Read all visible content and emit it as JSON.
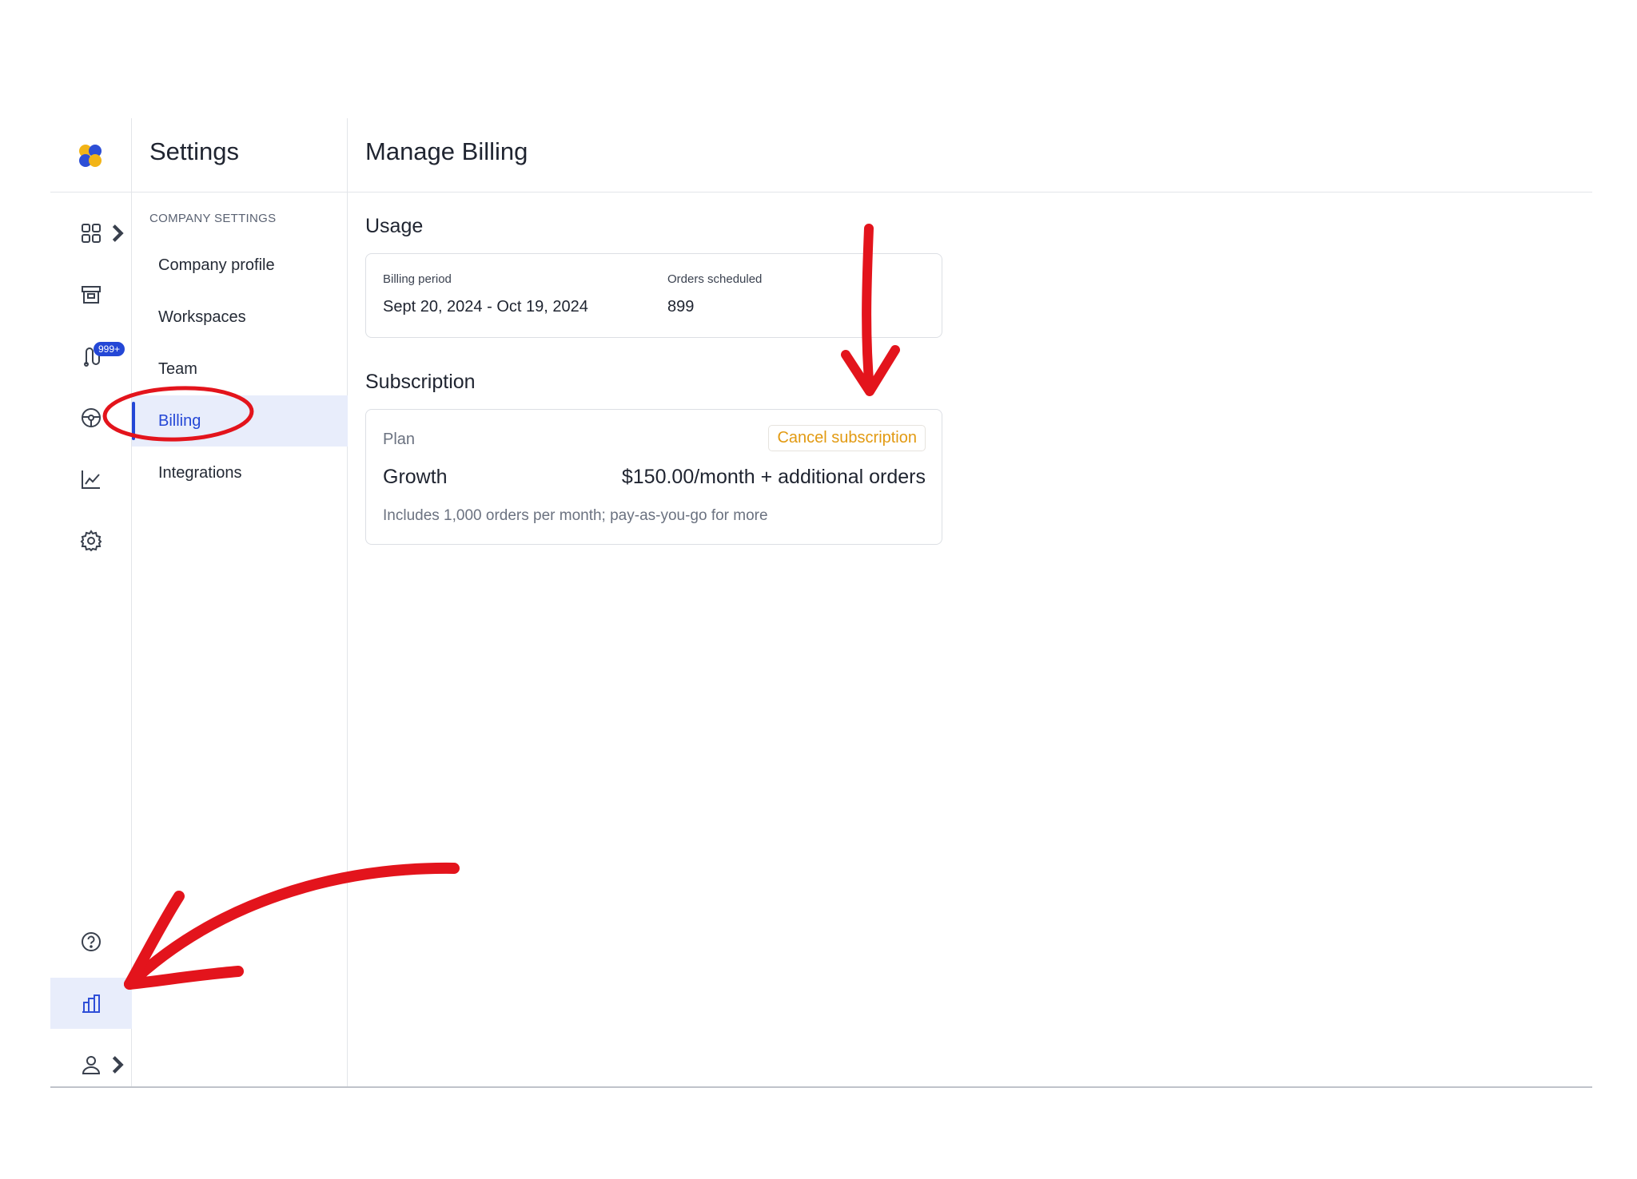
{
  "rail": {
    "badge": "999+"
  },
  "sidebar": {
    "title": "Settings",
    "section_label": "COMPANY SETTINGS",
    "items": [
      {
        "label": "Company profile"
      },
      {
        "label": "Workspaces"
      },
      {
        "label": "Team"
      },
      {
        "label": "Billing",
        "active": true
      },
      {
        "label": "Integrations"
      }
    ]
  },
  "main": {
    "title": "Manage Billing",
    "usage": {
      "heading": "Usage",
      "billing_period_label": "Billing period",
      "billing_period_value": "Sept 20, 2024 - Oct 19, 2024",
      "orders_label": "Orders scheduled",
      "orders_value": "899"
    },
    "subscription": {
      "heading": "Subscription",
      "plan_label": "Plan",
      "cancel_label": "Cancel subscription",
      "plan_name": "Growth",
      "price": "$150.00/month + additional orders",
      "description": "Includes 1,000 orders per month; pay-as-you-go for more"
    }
  },
  "colors": {
    "accent": "#2447d6",
    "active_bg": "#e8edfb",
    "cancel": "#e29a12",
    "annotation": "#e3141c"
  },
  "icons": [
    "logo-icon",
    "grid-icon",
    "archive-icon",
    "route-icon",
    "steering-wheel-icon",
    "chart-line-icon",
    "gear-icon",
    "help-icon",
    "building-icon",
    "user-icon",
    "chevron-right-icon"
  ]
}
